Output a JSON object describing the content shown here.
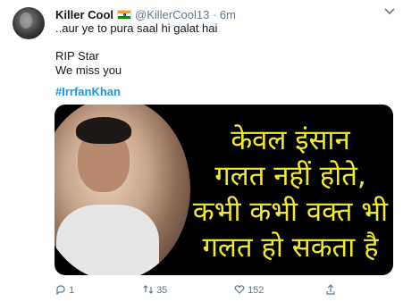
{
  "tweet": {
    "author_name": "Killer Cool",
    "handle": "@KillerCool13",
    "separator": "·",
    "time": "6m",
    "lines": [
      "..aur ye to pura saal hi galat hai",
      "RIP Star",
      "We miss you"
    ],
    "hashtag": "#IrrfanKhan",
    "image_text": [
      "केवल इंसान",
      "गलत नहीं होते,",
      "कभी कभी वक्त भी",
      "गलत हो सकता है"
    ]
  },
  "actions": {
    "reply_count": "1",
    "retweet_count": "35",
    "like_count": "152"
  },
  "icons": {
    "menu": "chevron-down-icon",
    "reply": "reply-icon",
    "retweet": "retweet-icon",
    "like": "heart-icon",
    "share": "share-icon"
  },
  "colors": {
    "link": "#1b95e0",
    "muted": "#657786",
    "image_text": "#f2ea2a"
  }
}
